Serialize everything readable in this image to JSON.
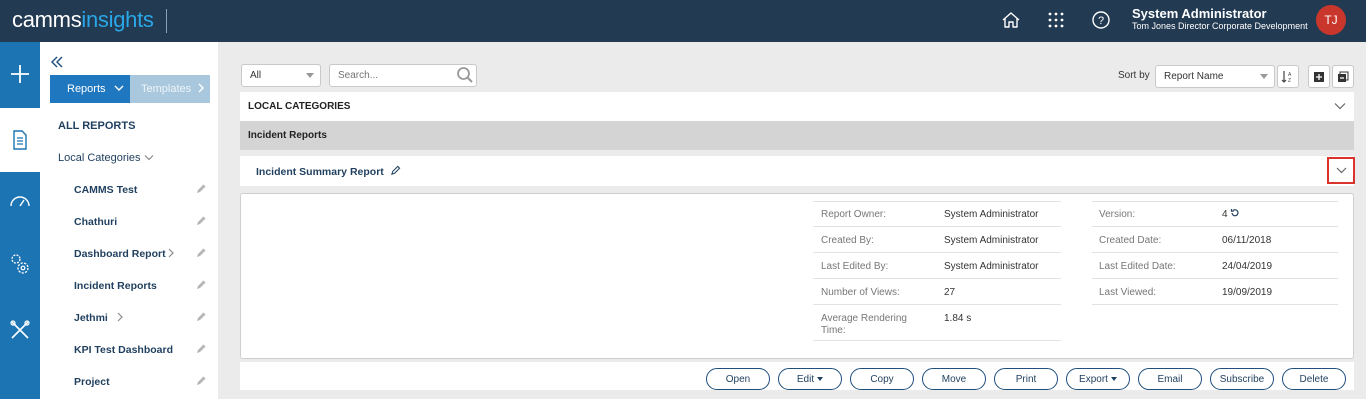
{
  "app": {
    "brand_part1": "camms",
    "brand_part2": "insights"
  },
  "header": {
    "user_name": "System Administrator",
    "user_title": "Tom Jones Director Corporate Development",
    "avatar_initials": "TJ",
    "icons": [
      "home-icon",
      "apps-grid-icon",
      "help-icon"
    ]
  },
  "rail": {
    "items": [
      "add-icon",
      "reports-doc-icon",
      "dashboard-gauge-icon",
      "settings-gears-icon",
      "tools-icon"
    ]
  },
  "sidebar": {
    "tab_reports": "Reports",
    "tab_templates": "Templates",
    "all_reports": "ALL REPORTS",
    "local_categories": "Local Categories",
    "items": [
      {
        "label": "CAMMS Test"
      },
      {
        "label": "Chathuri"
      },
      {
        "label": "Dashboard Report"
      },
      {
        "label": "Incident Reports"
      },
      {
        "label": "Jethmi"
      },
      {
        "label": "KPI Test Dashboard"
      },
      {
        "label": "Project"
      }
    ]
  },
  "filters": {
    "category_value": "All",
    "search_placeholder": "Search...",
    "sort_label": "Sort by",
    "sort_value": "Report Name"
  },
  "main": {
    "local_categories_header": "LOCAL CATEGORIES",
    "group_header": "Incident Reports",
    "report_title": "Incident Summary Report",
    "details_left": [
      {
        "label": "Report Owner:",
        "value": "System Administrator"
      },
      {
        "label": "Created By:",
        "value": "System Administrator"
      },
      {
        "label": "Last Edited By:",
        "value": "System Administrator"
      },
      {
        "label": "Number of Views:",
        "value": "27"
      },
      {
        "label": "Average Rendering Time:",
        "value": "1.84 s"
      }
    ],
    "details_right": [
      {
        "label": "Version:",
        "value": "4"
      },
      {
        "label": "Created Date:",
        "value": "06/11/2018"
      },
      {
        "label": "Last Edited Date:",
        "value": "24/04/2019"
      },
      {
        "label": "Last Viewed:",
        "value": "19/09/2019"
      }
    ]
  },
  "actions": {
    "open": "Open",
    "edit": "Edit",
    "copy": "Copy",
    "move": "Move",
    "print": "Print",
    "export": "Export",
    "email": "Email",
    "subscribe": "Subscribe",
    "delete": "Delete"
  },
  "colors": {
    "header": "#223a52",
    "rail": "#1d74b3",
    "accent": "#1f78bf",
    "highlight": "#d9332b"
  }
}
